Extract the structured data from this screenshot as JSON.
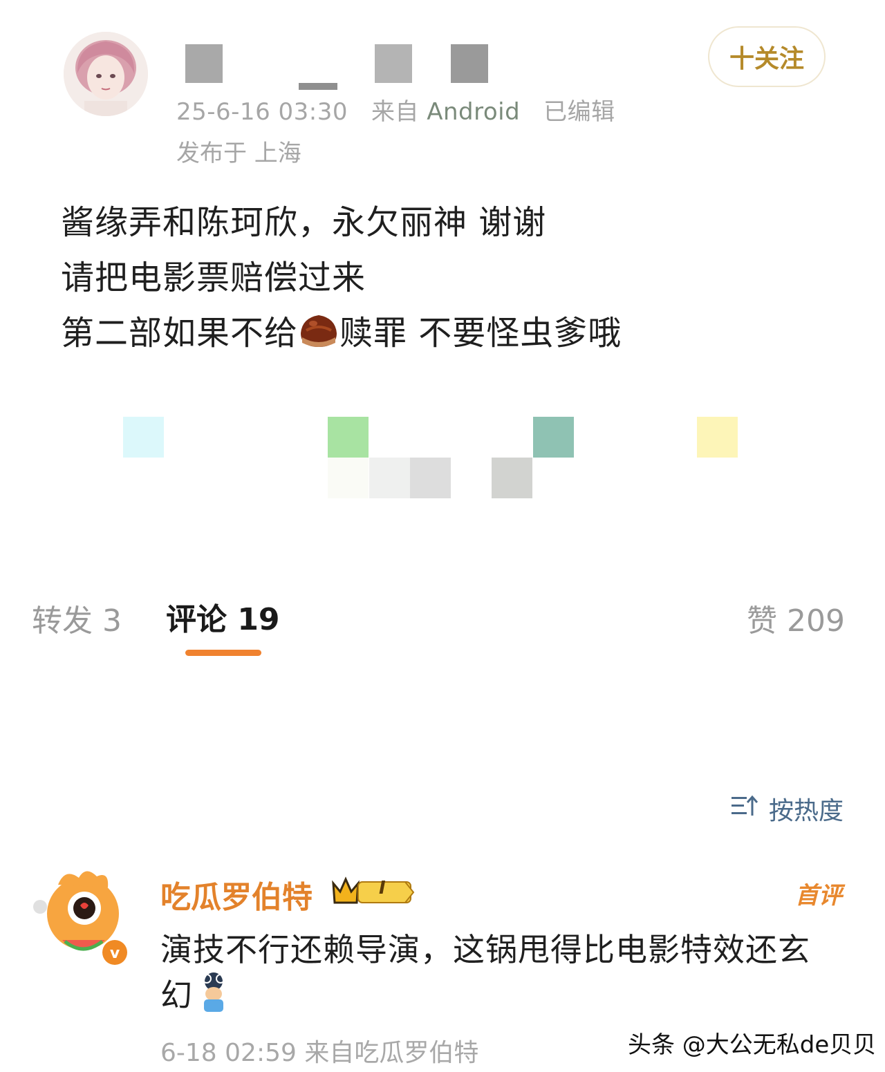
{
  "post": {
    "timestamp": "25-6-16 03:30",
    "source_prefix": "来自",
    "source": "Android",
    "edited": "已编辑",
    "location": "发布于 上海",
    "follow_label": "十关注",
    "lines": [
      "酱缘弄和陈珂欣，永欠丽神 谢谢",
      "请把电影票赔偿过来",
      "第二部如果不给",
      "赎罪 不要怪虫爹哦"
    ]
  },
  "tabs": {
    "repost": "转发 3",
    "comment": "评论 19",
    "like": "赞 209"
  },
  "sort": {
    "label": "按热度",
    "icon": "sort-icon"
  },
  "comment": {
    "username": "吃瓜罗伯特",
    "level": "I",
    "badge": "首评",
    "text_line1": "演技不行还赖导演，这锅甩得比电影特效还玄",
    "text_line2": "幻",
    "meta": "6-18 02:59 来自吃瓜罗伯特"
  },
  "watermark": "头条 @大公无私de贝贝",
  "colors": {
    "accent": "#f0822f",
    "username": "#e3822b",
    "sort": "#4a6a8a"
  }
}
